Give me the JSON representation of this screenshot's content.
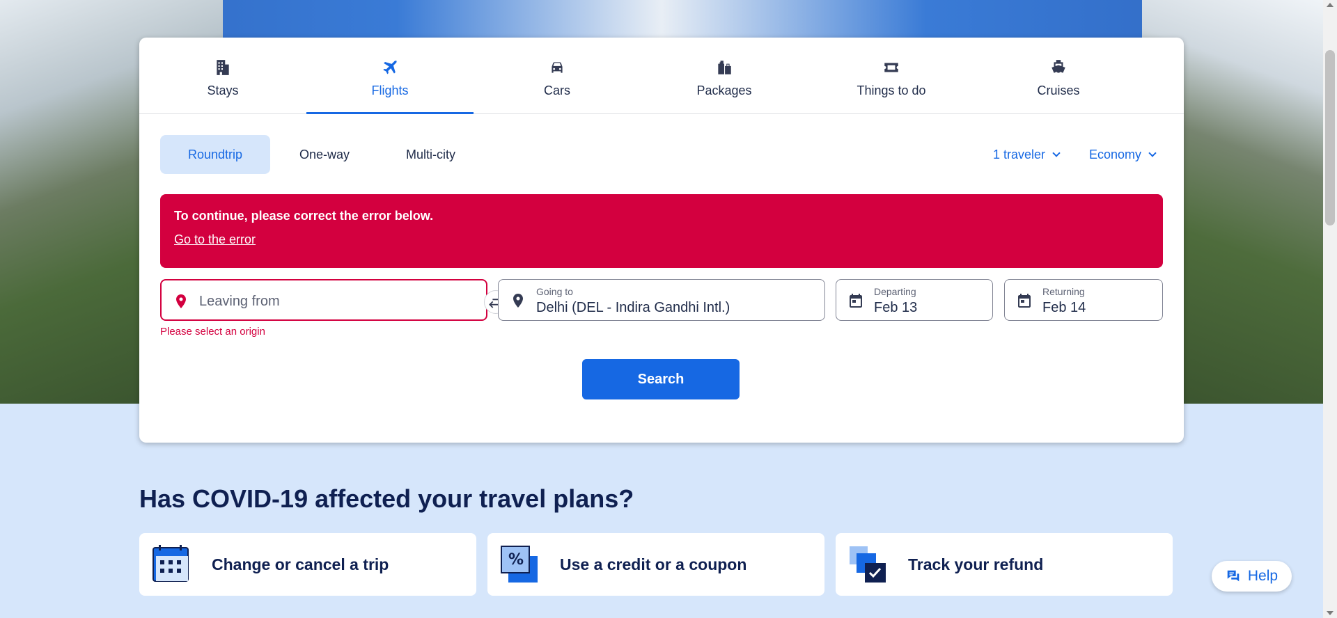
{
  "tabs": [
    {
      "label": "Stays",
      "icon": "building-icon"
    },
    {
      "label": "Flights",
      "icon": "plane-icon"
    },
    {
      "label": "Cars",
      "icon": "car-icon"
    },
    {
      "label": "Packages",
      "icon": "luggage-icon"
    },
    {
      "label": "Things to do",
      "icon": "ticket-icon"
    },
    {
      "label": "Cruises",
      "icon": "ship-icon"
    }
  ],
  "active_tab": "Flights",
  "trip_types": {
    "roundtrip": "Roundtrip",
    "one_way": "One-way",
    "multi_city": "Multi-city"
  },
  "travelers": "1 traveler",
  "cabin_class": "Economy",
  "error": {
    "title": "To continue, please correct the error below.",
    "link": "Go to the error",
    "field_message": "Please select an origin"
  },
  "leaving_from": {
    "placeholder": "Leaving from"
  },
  "going_to": {
    "label": "Going to",
    "value": "Delhi (DEL - Indira Gandhi Intl.)"
  },
  "departing": {
    "label": "Departing",
    "value": "Feb 13"
  },
  "returning": {
    "label": "Returning",
    "value": "Feb 14"
  },
  "search_label": "Search",
  "covid": {
    "title": "Has COVID-19 affected your travel plans?",
    "tiles": [
      {
        "label": "Change or cancel a trip"
      },
      {
        "label": "Use a credit or a coupon"
      },
      {
        "label": "Track your refund"
      }
    ]
  },
  "help_label": "Help",
  "colors": {
    "brand": "#1668e3",
    "error": "#d3003f",
    "navy": "#0f2051",
    "light_blue_bg": "#d6e6fb"
  }
}
